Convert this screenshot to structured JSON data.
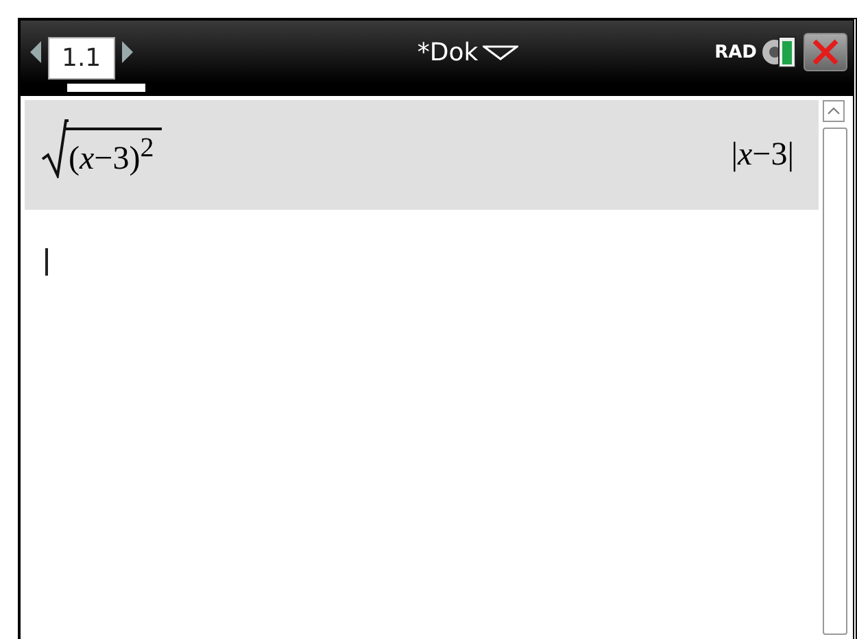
{
  "tabs": [
    {
      "label": "1.1",
      "selected": true
    }
  ],
  "document": {
    "title": "*Dok"
  },
  "status": {
    "angle_mode": "RAD"
  },
  "history": [
    {
      "input": "(*x*−3)$^{2}$",
      "kind": "sqrt",
      "output": "|*x*−3|",
      "selected": true
    }
  ],
  "entry_line": {
    "cursor": true
  }
}
